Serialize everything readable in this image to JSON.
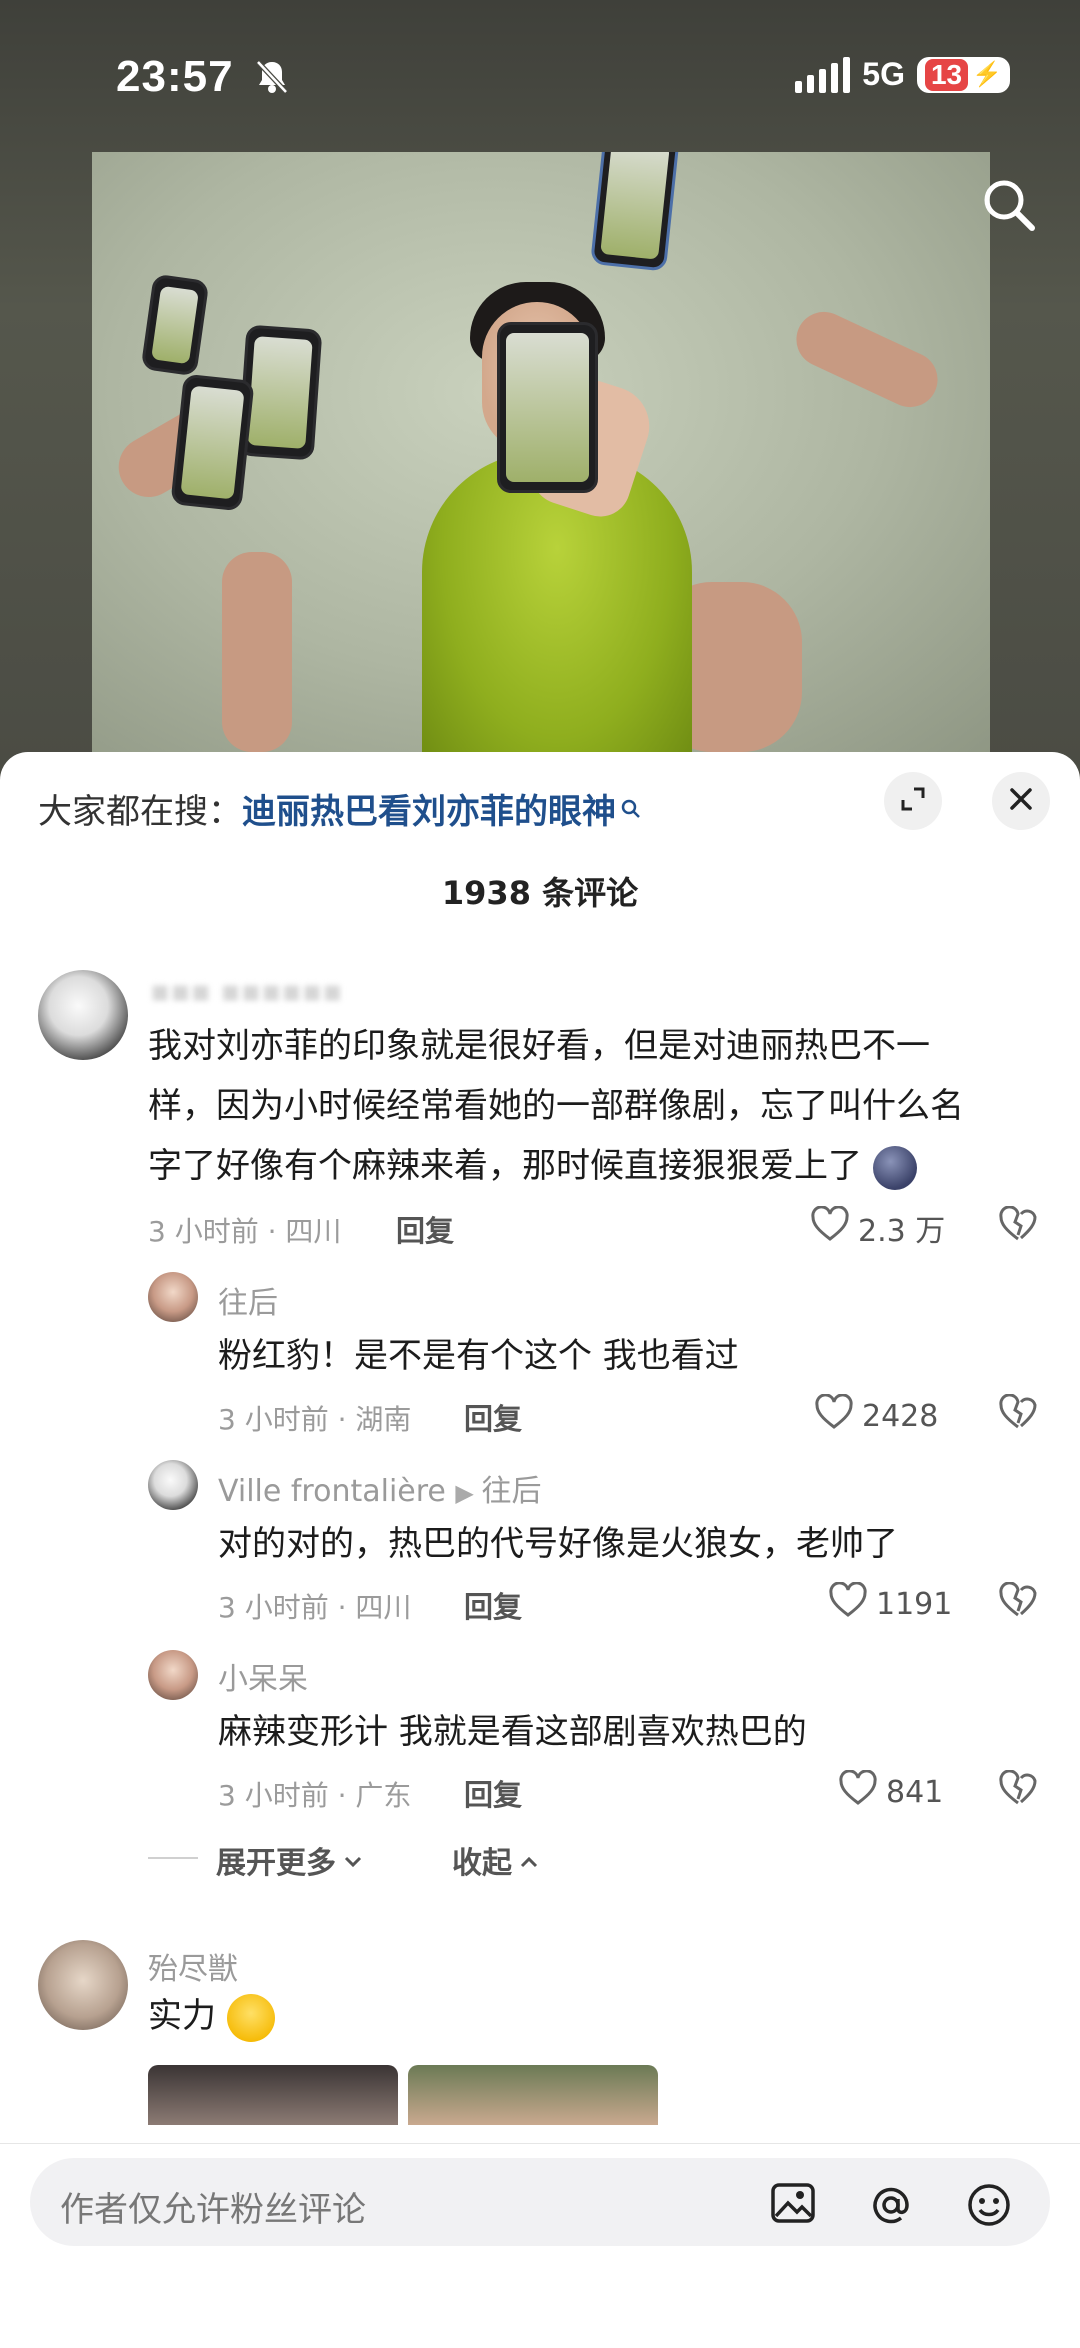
{
  "status_bar": {
    "time": "23:57",
    "network": "5G",
    "battery": "13"
  },
  "sheet": {
    "hot_search_prefix": "大家都在搜：",
    "hot_search_term": "迪丽热巴看刘亦菲的眼神",
    "comment_count": "1938 条评论"
  },
  "comments": [
    {
      "username": "▪▪▪ ▪▪▪▪▪▪",
      "lines": [
        "我对刘亦菲的印象就是很好看，但是对迪丽热巴不一",
        "样，因为小时候经常看她的一部群像剧，忘了叫什么名",
        "字了好像有个麻辣来着，那时候直接狠狠爱上了"
      ],
      "meta": "3 小时前 · 四川",
      "reply": "回复",
      "likes": "2.3 万"
    },
    {
      "username": "往后",
      "text": "粉红豹！是不是有个这个 我也看过",
      "meta": "3 小时前 · 湖南",
      "reply": "回复",
      "likes": "2428"
    },
    {
      "username": "Ville frontalière",
      "reply_to": "往后",
      "text": "对的对的，热巴的代号好像是火狼女，老帅了",
      "meta": "3 小时前 · 四川",
      "reply": "回复",
      "likes": "1191"
    },
    {
      "username": "小呆呆",
      "text": "麻辣变形计 我就是看这部剧喜欢热巴的",
      "meta": "3 小时前 · 广东",
      "reply": "回复",
      "likes": "841"
    }
  ],
  "expand_more": "展开更多",
  "collapse": "收起",
  "next_comment": {
    "username": "殆尽獣",
    "text": "实力"
  },
  "bottom_bar": {
    "placeholder": "作者仅允许粉丝评论"
  },
  "icons": {
    "mute": "bell-slash-icon",
    "search": "search-icon",
    "expand": "expand-icon",
    "close": "close-icon",
    "like": "heart-icon",
    "dislike": "broken-heart-icon",
    "image": "image-icon",
    "mention": "at-icon",
    "emoji": "smile-icon"
  }
}
